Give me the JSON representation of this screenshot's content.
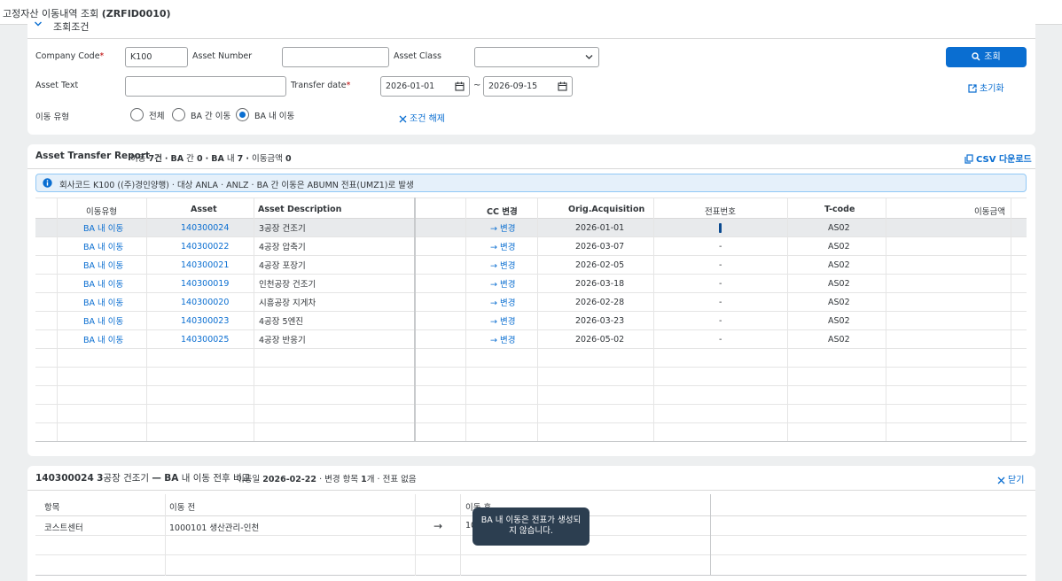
{
  "app": {
    "title": "고정자산 이동내역 조회",
    "tcode": "(ZRFID0010)"
  },
  "filter": {
    "section_label": "조회조건",
    "company_code": {
      "label": "Company Code",
      "value": "K100"
    },
    "asset_number": {
      "label": "Asset Number",
      "value": ""
    },
    "asset_class": {
      "label": "Asset Class",
      "value": ""
    },
    "asset_text": {
      "label": "Asset Text",
      "value": ""
    },
    "transfer_date": {
      "label": "Transfer date",
      "from": "2026-01-01",
      "to": "2026-09-15",
      "separator": "~"
    },
    "move_type": {
      "label": "이동 유형",
      "options": [
        "전체",
        "BA 간 이동",
        "BA 내 이동"
      ],
      "selected_index": 2
    },
    "clear_label": "조건 해제",
    "search_label": "조회",
    "reset_label": "초기화",
    "required_mark": "*"
  },
  "report": {
    "title": "Asset Transfer Report",
    "summary": {
      "t1": "이동",
      "count_total": "7건",
      "sep": "·",
      "t2": "BA 간",
      "count_between": "0",
      "t3": "BA 내",
      "count_within": "7",
      "t4": "이동금액",
      "amount": "0"
    },
    "csv_label": "CSV 다운로드",
    "info": "회사코드 K100 ((주)경인양행) · 대상 ANLA · ANLZ · BA 간 이동은 ABUMN 전표(UMZ1)로 발생",
    "columns": [
      "이동유형",
      "Asset",
      "Asset Description",
      "CC 변경",
      "Orig.Acquisition",
      "전표번호",
      "T-code",
      "이동금액"
    ],
    "rows": [
      {
        "type": "BA 내 이동",
        "asset": "140300024",
        "desc": "3공장 건조기",
        "cc": "→ 변경",
        "acq": "2026-01-01",
        "doc": "",
        "tcode": "AS02",
        "amount": ""
      },
      {
        "type": "BA 내 이동",
        "asset": "140300022",
        "desc": "4공장 압축기",
        "cc": "→ 변경",
        "acq": "2026-03-07",
        "doc": "-",
        "tcode": "AS02",
        "amount": ""
      },
      {
        "type": "BA 내 이동",
        "asset": "140300021",
        "desc": "4공장 포장기",
        "cc": "→ 변경",
        "acq": "2026-02-05",
        "doc": "-",
        "tcode": "AS02",
        "amount": ""
      },
      {
        "type": "BA 내 이동",
        "asset": "140300019",
        "desc": "인천공장 건조기",
        "cc": "→ 변경",
        "acq": "2026-03-18",
        "doc": "-",
        "tcode": "AS02",
        "amount": ""
      },
      {
        "type": "BA 내 이동",
        "asset": "140300020",
        "desc": "시흥공장 지게차",
        "cc": "→ 변경",
        "acq": "2026-02-28",
        "doc": "-",
        "tcode": "AS02",
        "amount": ""
      },
      {
        "type": "BA 내 이동",
        "asset": "140300023",
        "desc": "4공장 5엔진",
        "cc": "→ 변경",
        "acq": "2026-03-23",
        "doc": "-",
        "tcode": "AS02",
        "amount": ""
      },
      {
        "type": "BA 내 이동",
        "asset": "140300025",
        "desc": "4공장 반응기",
        "cc": "→ 변경",
        "acq": "2026-05-02",
        "doc": "-",
        "tcode": "AS02",
        "amount": ""
      }
    ]
  },
  "compare": {
    "title_asset": "140300024",
    "title_desc": "3공장 건조기",
    "title_dash": "—",
    "title_ba": "BA",
    "title_rest": "내 이동 전후 비교",
    "sub_date_label": "이동일",
    "sub_date": "2026-02-22",
    "sub_changes_label": "· 변경 항목",
    "sub_changes": "1개",
    "sub_doc": "· 전표 없음",
    "close_label": "닫기",
    "columns": [
      "항목",
      "이동 전",
      "이동 후"
    ],
    "row": {
      "item": "코스트센터",
      "before": "1000101 생산관리-인천",
      "arrow": "→",
      "after": "10"
    }
  },
  "tooltip": {
    "line1": "BA 내 이동은 전표가 생성되",
    "line2": "지 않습니다."
  },
  "colors": {
    "accent": "#0a6ed1",
    "required": "#bb0000",
    "tooltip_bg": "#2c3e50"
  }
}
